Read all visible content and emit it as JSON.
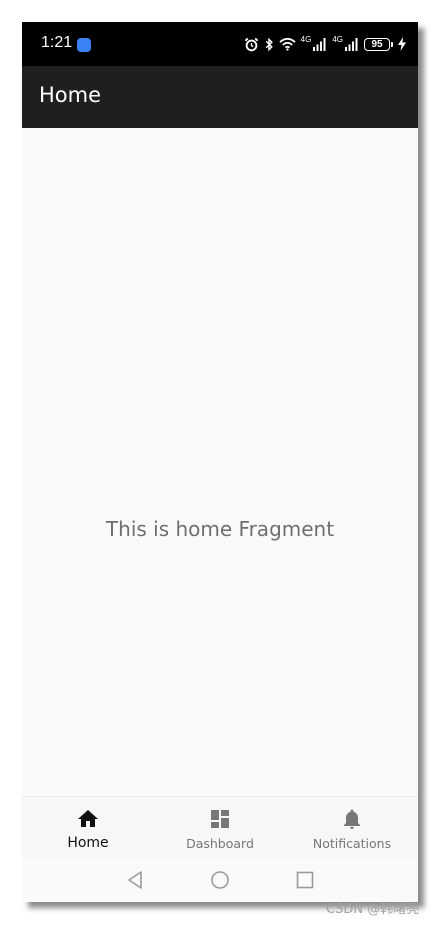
{
  "status_bar": {
    "time": "1:21",
    "battery_level": "95",
    "network_labels": [
      "4G",
      "4G"
    ],
    "icons": [
      "app-notification-icon",
      "alarm-icon",
      "bluetooth-icon",
      "wifi-icon",
      "signal-icon",
      "signal-icon",
      "battery-icon",
      "charging-icon"
    ]
  },
  "toolbar": {
    "title": "Home"
  },
  "content": {
    "text": "This is home Fragment"
  },
  "bottom_nav": {
    "items": [
      {
        "label": "Home",
        "icon": "home-icon",
        "active": true
      },
      {
        "label": "Dashboard",
        "icon": "dashboard-icon",
        "active": false
      },
      {
        "label": "Notifications",
        "icon": "bell-icon",
        "active": false
      }
    ]
  },
  "system_nav": {
    "icons": [
      "back-icon",
      "home-circle-icon",
      "recents-icon"
    ]
  },
  "watermark": {
    "text": "CSDN @韩曙亮"
  },
  "colors": {
    "status_bar": "#000000",
    "toolbar": "#1f1f1f",
    "background": "#fafafa",
    "bottom_nav": "#f7f7f7",
    "active_nav": "#111111",
    "inactive_nav": "#777777",
    "content_text": "#6f6f6f",
    "app_badge": "#3b82f6"
  }
}
